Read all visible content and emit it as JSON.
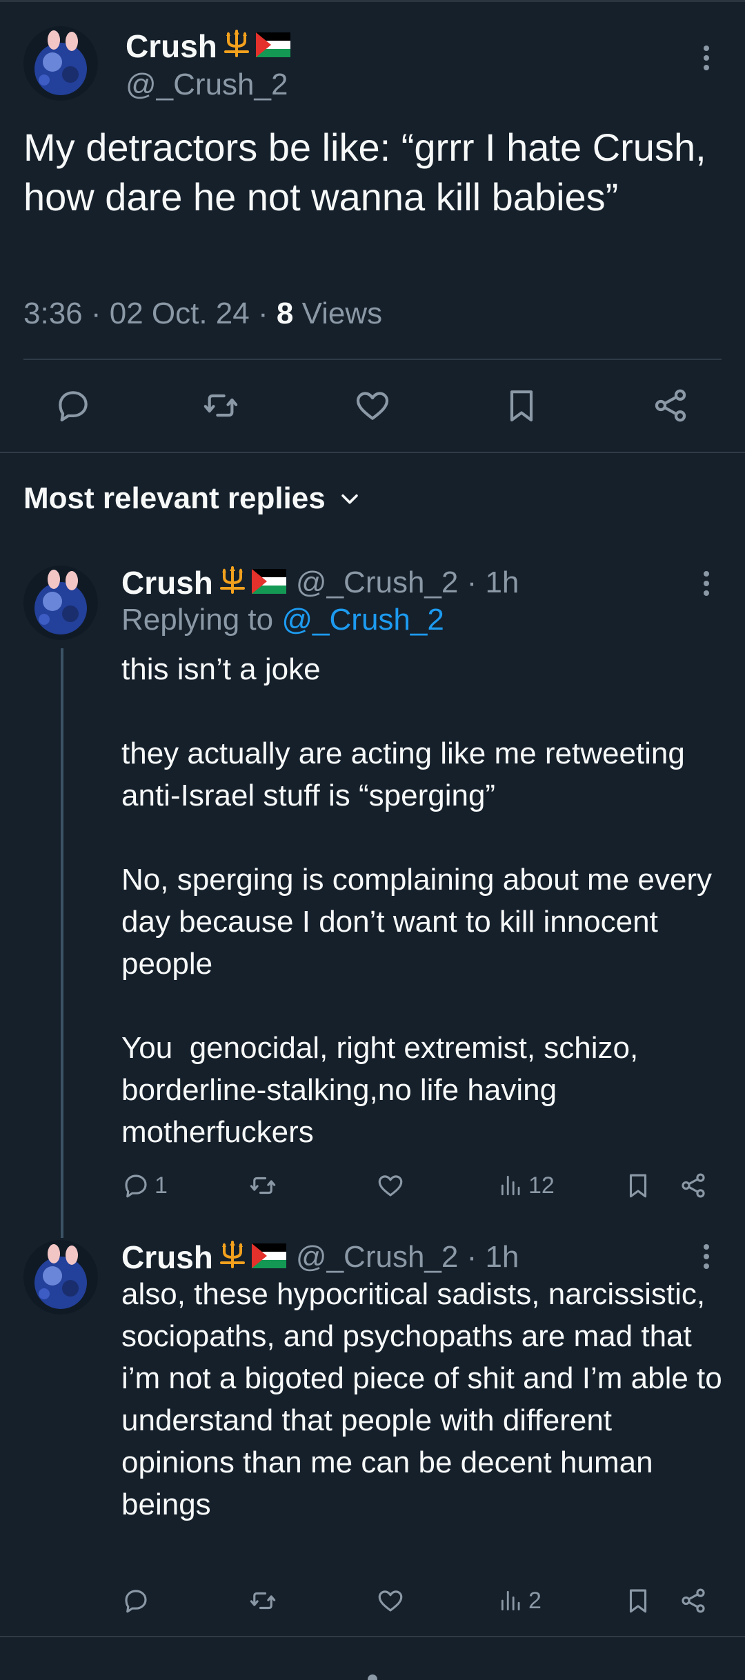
{
  "post": {
    "author_name": "Crush",
    "author_handle": "@_Crush_2",
    "text": "My detractors be like: “grrr I hate Crush, how dare he not wanna kill babies”",
    "time": "3:36 · 02 Oct. 24 ·",
    "views_count": "8",
    "views_label": "Views"
  },
  "replies_section": {
    "title": "Most relevant replies"
  },
  "replies": [
    {
      "author_name": "Crush",
      "author_meta": "@_Crush_2 · 1h",
      "replying_prefix": "Replying to",
      "replying_handle": "@_Crush_2",
      "text": "this isn’t a joke\n\nthey actually are acting like me retweeting anti-Israel stuff is “sperging”\n\nNo, sperging is complaining about me every day because I don’t want to kill innocent people\n\nYou  genocidal, right extremist, schizo, borderline-stalking,no life having motherfuckers",
      "reply_count": "1",
      "views_count": "12"
    },
    {
      "author_name": "Crush",
      "author_meta": "@_Crush_2 · 1h",
      "text": "also, these hypocritical sadists, narcissistic, sociopaths, and psychopaths are mad that i’m not a bigoted piece of shit and I’m able to understand that people with different opinions than me can be decent human beings",
      "views_count": "2"
    }
  ],
  "icons": {
    "emoji_1": "trident-emoji",
    "emoji_2": "palestine-flag-emoji",
    "more": "more-vertical-icon",
    "reply": "reply-icon",
    "retweet": "retweet-icon",
    "like": "like-icon",
    "bookmark": "bookmark-icon",
    "share": "share-icon",
    "views": "views-icon",
    "chevron": "chevron-down-icon"
  },
  "colors": {
    "background": "#15202b",
    "text": "#f7f9f9",
    "muted": "#8b98a5",
    "link": "#1d9bf0",
    "separator": "#2f3b47"
  }
}
